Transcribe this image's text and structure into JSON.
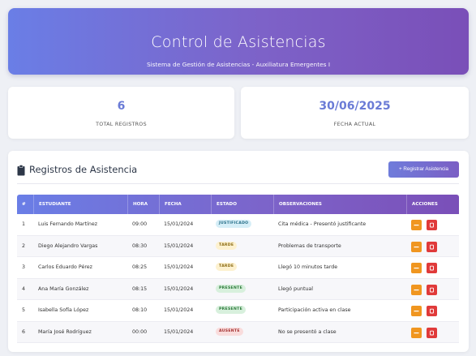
{
  "header": {
    "title": "Control de Asistencias",
    "subtitle": "Sistema de Gestión de Asistencias - Auxiliatura Emergentes I"
  },
  "stats": [
    {
      "value": "6",
      "label": "TOTAL REGISTROS"
    },
    {
      "value": "30/06/2025",
      "label": "FECHA ACTUAL"
    }
  ],
  "panel": {
    "title": "Registros de Asistencia",
    "add_button": "+ Registrar Asistencia"
  },
  "table": {
    "columns": [
      "#",
      "ESTUDIANTE",
      "HORA",
      "FECHA",
      "ESTADO",
      "OBSERVACIONES",
      "ACCIONES"
    ],
    "rows": [
      {
        "num": "1",
        "student": "Luis Fernando Martínez",
        "time": "09:00",
        "date": "15/01/2024",
        "status": "JUSTIFICADO",
        "notes": "Cita médica - Presentó justificante"
      },
      {
        "num": "2",
        "student": "Diego Alejandro Vargas",
        "time": "08:30",
        "date": "15/01/2024",
        "status": "TARDE",
        "notes": "Problemas de transporte"
      },
      {
        "num": "3",
        "student": "Carlos Eduardo Pérez",
        "time": "08:25",
        "date": "15/01/2024",
        "status": "TARDE",
        "notes": "Llegó 10 minutos tarde"
      },
      {
        "num": "4",
        "student": "Ana María González",
        "time": "08:15",
        "date": "15/01/2024",
        "status": "PRESENTE",
        "notes": "Llegó puntual"
      },
      {
        "num": "5",
        "student": "Isabella Sofía López",
        "time": "08:10",
        "date": "15/01/2024",
        "status": "PRESENTE",
        "notes": "Participación activa en clase"
      },
      {
        "num": "6",
        "student": "María José Rodríguez",
        "time": "00:00",
        "date": "15/01/2024",
        "status": "AUSENTE",
        "notes": "No se presentó a clase"
      }
    ]
  },
  "icons": {
    "panel_icon": "clipboard-icon",
    "edit": "edit-icon",
    "delete": "delete-icon"
  },
  "colors": {
    "accent_start": "#6a7ee6",
    "accent_end": "#7a4fb8",
    "edit": "#f09620",
    "delete": "#e03a3a"
  }
}
